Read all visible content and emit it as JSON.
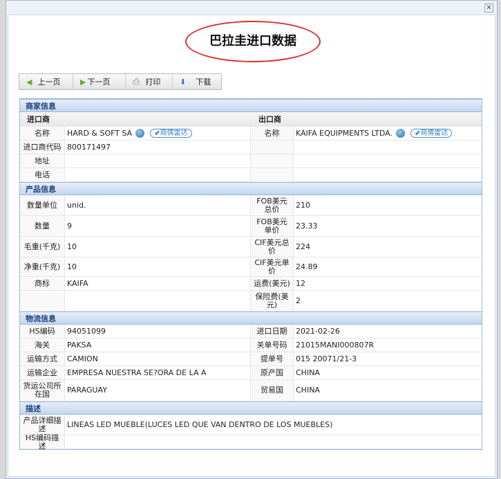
{
  "title": "巴拉圭进口数据",
  "toolbar": {
    "prev": "上一页",
    "next": "下一页",
    "print": "打印",
    "download": "下载"
  },
  "merchant": {
    "section": "商家信息",
    "importer": "进口商",
    "exporter": "出口商",
    "radar": "商情雷达",
    "rows": [
      {
        "l": "名称",
        "v": "HARD & SOFT SA",
        "l2": "名称",
        "v2": "KAIFA EQUIPMENTS LTDA."
      },
      {
        "l": "进口商代码",
        "v": "800171497",
        "l2": "",
        "v2": ""
      },
      {
        "l": "地址",
        "v": "",
        "l2": "",
        "v2": ""
      },
      {
        "l": "电话",
        "v": "",
        "l2": "",
        "v2": ""
      }
    ]
  },
  "product": {
    "section": "产品信息",
    "rows": [
      {
        "l": "数量单位",
        "v": "unid.",
        "l2": "FOB美元总价",
        "v2": "210"
      },
      {
        "l": "数量",
        "v": "9",
        "l2": "FOB美元单价",
        "v2": "23.33"
      },
      {
        "l": "毛重(千克)",
        "v": "10",
        "l2": "CIF美元总价",
        "v2": "224"
      },
      {
        "l": "净重(千克)",
        "v": "10",
        "l2": "CIF美元单价",
        "v2": "24.89"
      },
      {
        "l": "商标",
        "v": "KAIFA",
        "l2": "运费(美元)",
        "v2": "12"
      },
      {
        "l": "",
        "v": "",
        "l2": "保险费(美元)",
        "v2": "2"
      }
    ]
  },
  "logistics": {
    "section": "物流信息",
    "rows": [
      {
        "l": "HS编码",
        "v": "94051099",
        "l2": "进口日期",
        "v2": "2021-02-26"
      },
      {
        "l": "海关",
        "v": "PAKSA",
        "l2": "关单号码",
        "v2": "21015MANI000807R"
      },
      {
        "l": "运输方式",
        "v": "CAMION",
        "l2": "提单号",
        "v2": "015 20071/21-3"
      },
      {
        "l": "运输企业",
        "v": "EMPRESA NUESTRA SE?ORA DE LA A",
        "l2": "原产国",
        "v2": "CHINA"
      },
      {
        "l": "货运公司所在国",
        "v": "PARAGUAY",
        "l2": "贸易国",
        "v2": "CHINA"
      }
    ]
  },
  "description": {
    "section": "描述",
    "rows": [
      {
        "l": "产品详细描述",
        "v": "LINEAS LED MUEBLE(LUCES LED QUE VAN DENTRO DE LOS MUEBLES)"
      },
      {
        "l": "HS编码描述",
        "v": ""
      }
    ]
  }
}
